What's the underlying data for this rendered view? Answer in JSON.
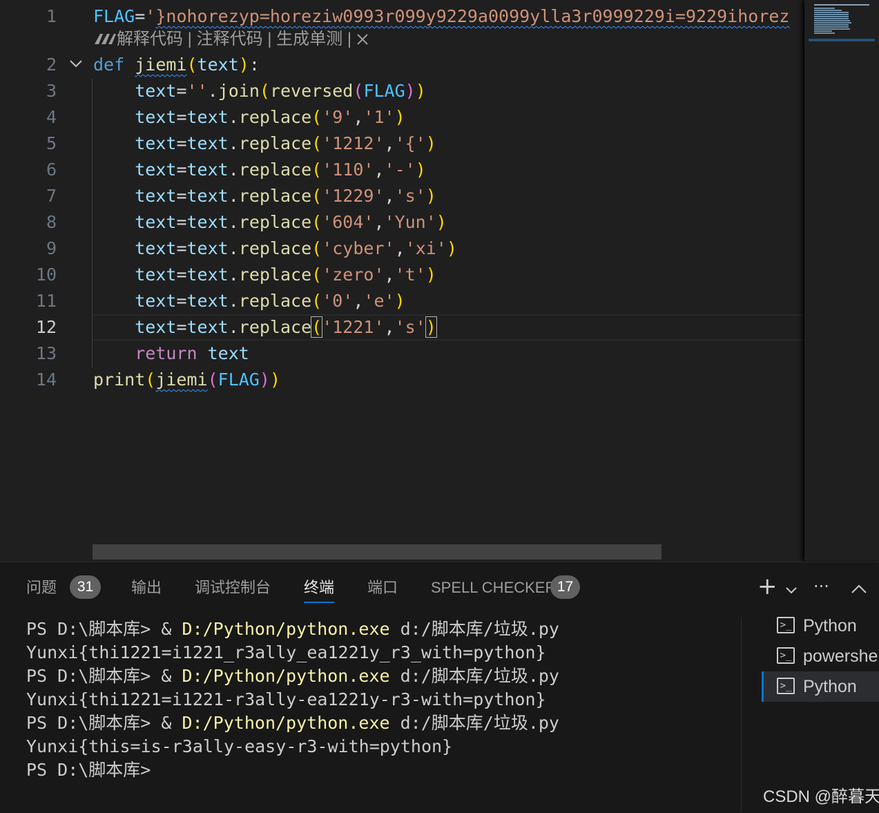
{
  "editor": {
    "line_numbers": [
      "1",
      "2",
      "3",
      "4",
      "5",
      "6",
      "7",
      "8",
      "9",
      "10",
      "11",
      "12",
      "13",
      "14"
    ],
    "codelens": {
      "explain": "解释代码",
      "sep1": " | ",
      "comment": "注释代码",
      "sep2": " | ",
      "unittest": "生成单测",
      "sep3": " | "
    },
    "line1": {
      "name": "FLAG",
      "eq": "=",
      "quote": "'",
      "value": "}nohorezyp=horeziw0993r099y9229a0099ylla3r0999229i=9229ihorez"
    },
    "line2": {
      "kw": "def",
      "space": " ",
      "fn": "jiemi",
      "open": "(",
      "param": "text",
      "close": ")",
      "colon": ":"
    },
    "line3": {
      "indent": "    ",
      "var": "text",
      "eq": "=",
      "empty": "''",
      "dot": ".",
      "fn": "join",
      "o1": "(",
      "fn2": "reversed",
      "o2": "(",
      "arg": "FLAG",
      "c2": ")",
      "c1": ")"
    },
    "replace_lines": [
      {
        "a": "'9'",
        "b": "'1'"
      },
      {
        "a": "'1212'",
        "b": "'{'"
      },
      {
        "a": "'110'",
        "b": "'-'"
      },
      {
        "a": "'1229'",
        "b": "'s'"
      },
      {
        "a": "'604'",
        "b": "'Yun'"
      },
      {
        "a": "'cyber'",
        "b": "'xi'"
      },
      {
        "a": "'zero'",
        "b": "'t'"
      },
      {
        "a": "'0'",
        "b": "'e'"
      },
      {
        "a": "'1221'",
        "b": "'s'"
      }
    ],
    "replace_parts": {
      "indent": "    ",
      "var": "text",
      "eq": "=",
      "obj": "text",
      "dot": ".",
      "fn": "replace",
      "open": "(",
      "comma": ",",
      "close": ")"
    },
    "line13": {
      "indent": "    ",
      "kw": "return",
      "space": " ",
      "var": "text"
    },
    "line14": {
      "fn": "print",
      "o1": "(",
      "fn2": "jiemi",
      "o2": "(",
      "arg": "FLAG",
      "c2": ")",
      "c1": ")"
    }
  },
  "panel": {
    "tabs": [
      {
        "label": "问题",
        "badge": "31"
      },
      {
        "label": "输出"
      },
      {
        "label": "调试控制台"
      },
      {
        "label": "终端",
        "active": true
      },
      {
        "label": "端口"
      },
      {
        "label": "SPELL CHECKER",
        "badge": "17"
      }
    ],
    "tools": {
      "add": "+",
      "chevron": "⌵",
      "more": "···",
      "collapse": "︿"
    },
    "terminal": {
      "prompt": "PS D:\\脚本库> ",
      "amp": "& ",
      "exe": "D:/Python/python.exe",
      "script": " d:/脚本库/垃圾.py",
      "outputs": [
        "Yunxi{thi1221=i1221_r3ally_ea1221y_r3_with=python}",
        "Yunxi{thi1221=i1221-r3ally-ea1221y-r3-with=python}",
        "Yunxi{this=is-r3ally-easy-r3-with=python}"
      ]
    },
    "terminal_list": [
      {
        "label": "Python"
      },
      {
        "label": "powershell"
      },
      {
        "label": "Python",
        "selected": true
      }
    ]
  },
  "watermark": "CSDN @醉暮天",
  "colors": {
    "keyword": "#569cd6",
    "function": "#dcdcaa",
    "variable": "#9cdcfe",
    "string": "#ce9178",
    "accent": "#0078d4"
  }
}
